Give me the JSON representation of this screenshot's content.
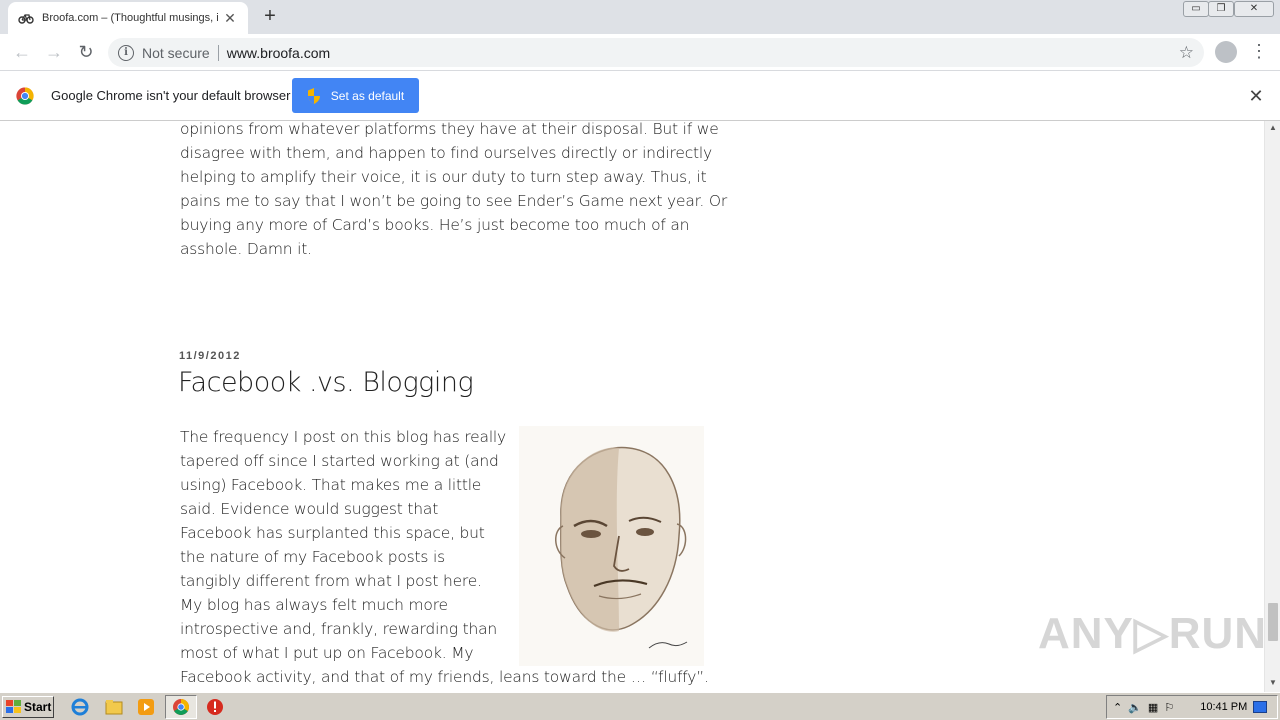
{
  "browser": {
    "tab_title": "Broofa.com – (Thoughtful musings, i",
    "tab_close": "✕",
    "new_tab": "+",
    "window_min": "▭",
    "window_restore": "❐",
    "window_close": "✕",
    "back": "←",
    "forward": "→",
    "reload": "↻",
    "security_label": "Not secure",
    "url": "www.broofa.com",
    "star": "☆",
    "menu": "⋮"
  },
  "infobar": {
    "message": "Google Chrome isn't your default browser",
    "button_label": "Set as default",
    "close": "✕"
  },
  "article": {
    "lines_prev": [
      "opinions from whatever platforms they have at their disposal.  But if we",
      "disagree with them, and happen to find ourselves directly or indirectly",
      "helping to amplify their voice, it is our duty to turn step away.  Thus, it",
      "pains me to say that I won’t be going to see Ender’s Game next year.  Or",
      "buying any more of Card’s books.  He’s just become too much of an",
      "asshole.  Damn it."
    ],
    "date": "11/9/2012",
    "title": "Facebook .vs. Blogging",
    "lines_post": [
      "The frequency I post on this blog has really",
      "tapered off since I started working at (and",
      "using) Facebook.  That makes me a little",
      "said.  Evidence would suggest that",
      "Facebook has surplanted this space, but",
      "the nature of my Facebook posts is",
      "tangibly different from what I post here.",
      "My blog has always felt much more",
      "introspective and, frankly, rewarding than",
      "most of what I put up on Facebook.  My",
      "Facebook activity, and that of my friends, leans toward the … “fluffy”."
    ]
  },
  "scrollbar": {
    "up": "▲",
    "down": "▼"
  },
  "watermark": "ANY▷RUN",
  "taskbar": {
    "start_label": "Start",
    "clock": "10:41 PM"
  },
  "colors": {
    "accent": "#4285f4",
    "tab_strip": "#dee1e6",
    "taskbar": "#d4d0c8"
  }
}
